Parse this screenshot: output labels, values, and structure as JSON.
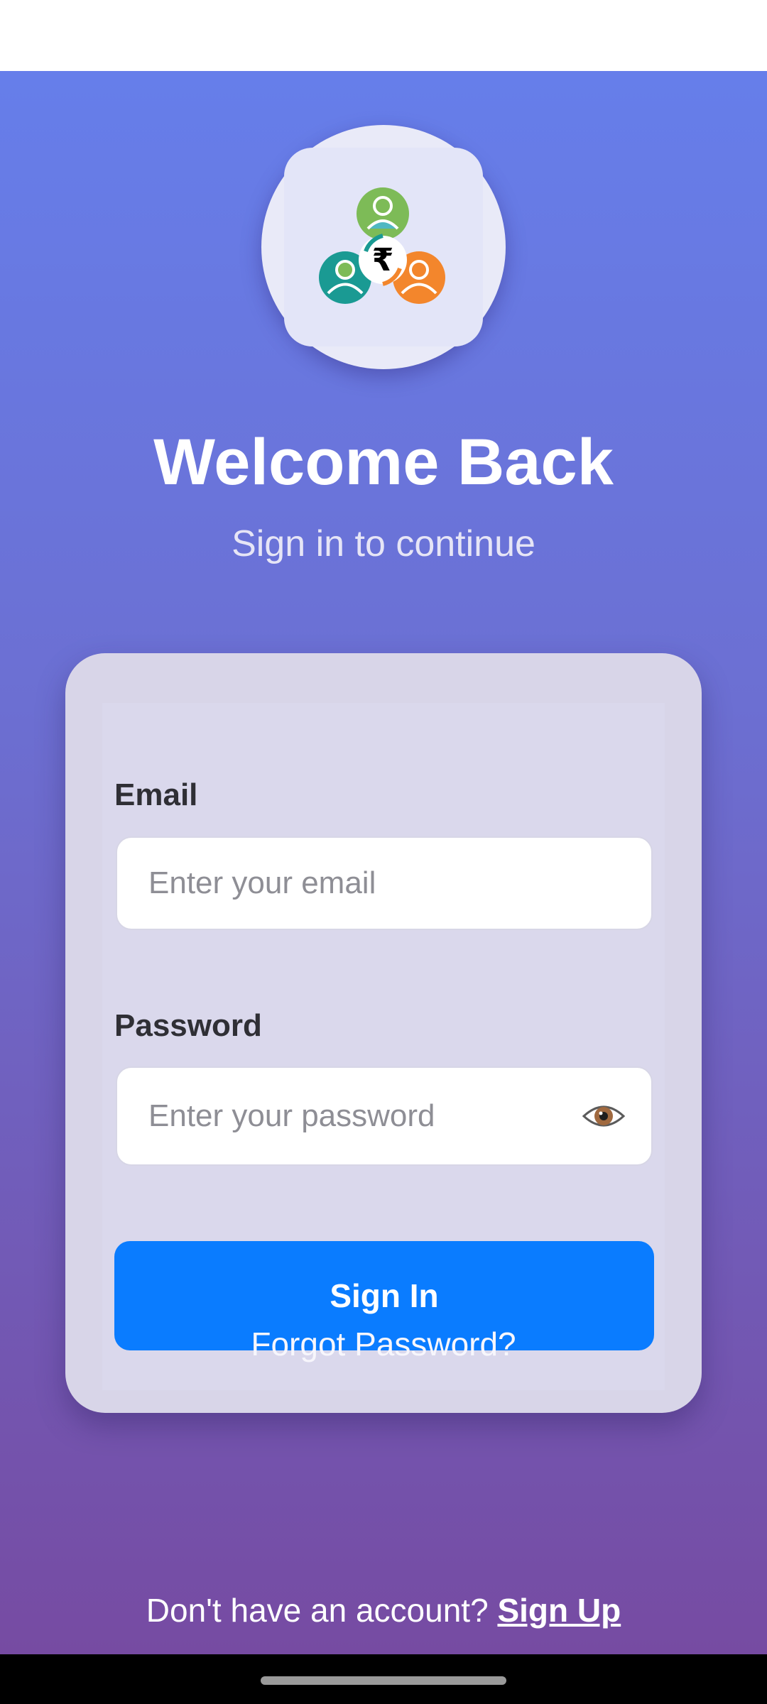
{
  "header": {
    "title": "Welcome Back",
    "subtitle": "Sign in to continue"
  },
  "logo": {
    "icon": "group-rupee-icon",
    "symbol": "₹",
    "colors": {
      "green": "#7dbb57",
      "teal": "#1a9a93",
      "orange": "#f3862c",
      "dark": "#000000"
    }
  },
  "form": {
    "email_label": "Email",
    "email_placeholder": "Enter your email",
    "email_value": "",
    "password_label": "Password",
    "password_placeholder": "Enter your password",
    "password_value": "",
    "password_toggle_icon": "eye-icon",
    "signin_label": "Sign In",
    "forgot_label": "Forgot Password?"
  },
  "footer": {
    "prompt": "Don't have an account? ",
    "signup_label": "Sign Up"
  },
  "colors": {
    "gradient_top": "#667eea",
    "gradient_bottom": "#764ba2",
    "primary_button": "#0a7cff",
    "card_bg": "#d8d5e8"
  }
}
